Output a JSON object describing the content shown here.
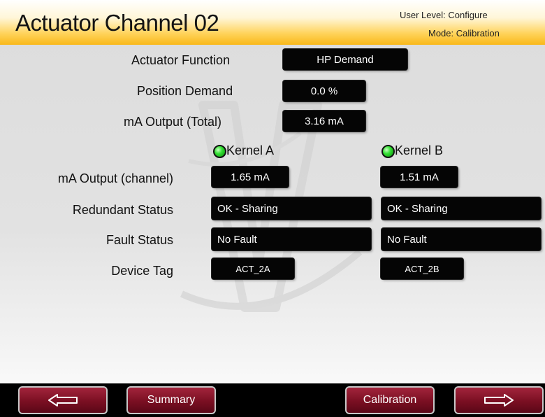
{
  "header": {
    "title": "Actuator Channel 02",
    "user_level": "User Level: Configure",
    "mode": "Mode: Calibration"
  },
  "actuator_function": {
    "label": "Actuator Function",
    "value": "HP Demand"
  },
  "position_demand": {
    "label": "Position Demand",
    "value": "0.0 %"
  },
  "ma_output_total": {
    "label": "mA Output (Total)",
    "value": "3.16 mA"
  },
  "kernels": {
    "a": {
      "name": "Kernel A",
      "status_color": "#2fd62f",
      "ma_output": "1.65 mA",
      "redundant_status": "OK - Sharing",
      "fault_status": "No Fault",
      "device_tag": "ACT_2A"
    },
    "b": {
      "name": "Kernel B",
      "status_color": "#2fd62f",
      "ma_output": "1.51 mA",
      "redundant_status": "OK - Sharing",
      "fault_status": "No Fault",
      "device_tag": "ACT_2B"
    }
  },
  "row_labels": {
    "ma_output_channel": "mA Output (channel)",
    "redundant_status": "Redundant Status",
    "fault_status": "Fault Status",
    "device_tag": "Device Tag"
  },
  "footer": {
    "back_icon": "left-arrow-icon",
    "summary_label": "Summary",
    "calibration_label": "Calibration",
    "forward_icon": "right-arrow-icon",
    "button_color": "#7a0f22"
  }
}
